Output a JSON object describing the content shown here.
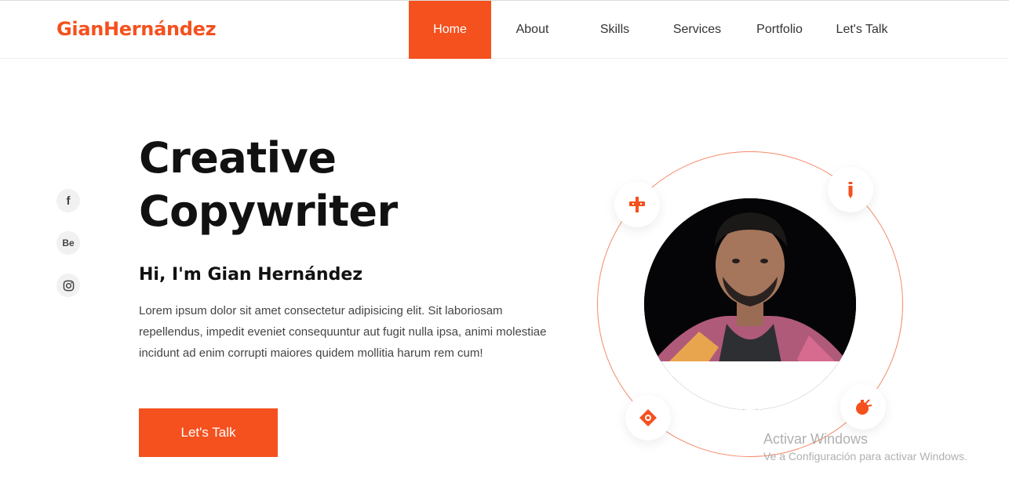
{
  "header": {
    "brand": "GianHernández",
    "nav": [
      {
        "label": "Home",
        "active": true
      },
      {
        "label": "About"
      },
      {
        "label": "Skills"
      },
      {
        "label": "Services"
      },
      {
        "label": "Portfolio"
      },
      {
        "label": "Let's Talk"
      }
    ]
  },
  "social": [
    {
      "icon": "facebook-icon",
      "glyph": "f"
    },
    {
      "icon": "behance-icon",
      "glyph": "Be"
    },
    {
      "icon": "instagram-icon"
    }
  ],
  "hero": {
    "title_line1": "Creative",
    "title_line2": "Copywriter",
    "greeting": "Hi, I'm Gian Hernández",
    "description": "Lorem ipsum dolor sit amet consectetur adipisicing elit. Sit laboriosam repellendus, impedit eveniet consequuntur aut fugit nulla ipsa, animi molestiae incidunt ad enim corrupti maiores quidem mollitia harum rem cum!",
    "cta_label": "Let's Talk"
  },
  "orbit_icons": [
    "compass-icon",
    "pencil-icon",
    "target-icon",
    "bulb-icon"
  ],
  "watermark": {
    "title": "Activar Windows",
    "subtitle": "Ve a Configuración para activar Windows."
  },
  "colors": {
    "accent": "#f4511e",
    "orbit": "#f58a6a",
    "text_dark": "#111111",
    "text_body": "#444444"
  }
}
